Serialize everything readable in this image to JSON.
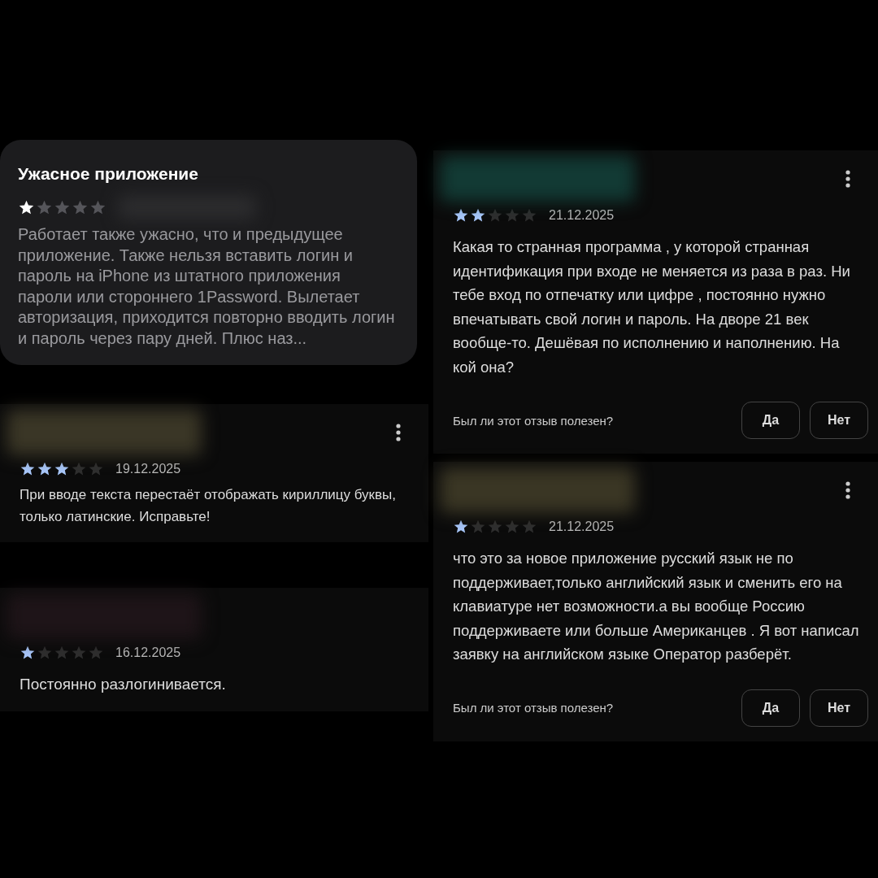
{
  "reviews": [
    {
      "kind": "ios",
      "title": "Ужасное приложение",
      "stars": 1,
      "body": "Работает также ужасно, что и предыдущее приложение. Также нельзя вставить логин и пароль на iPhone из штатного приложения пароли или стороннего 1Password. Вылетает авторизация, приходится повторно вводить логин и пароль через пару дней. Плюс наз..."
    },
    {
      "kind": "android",
      "menu": true,
      "stars": 3,
      "date": "19.12.2025",
      "body": "При вводе текста перестаёт отображать кириллицу буквы, только латинские. Исправьте!"
    },
    {
      "kind": "android",
      "menu": false,
      "stars": 1,
      "date": "16.12.2025",
      "body": "Постоянно разлогинивается."
    },
    {
      "kind": "android",
      "menu": true,
      "stars": 2,
      "date": "21.12.2025",
      "body": "Какая то странная программа , у которой странная идентификация при входе не меняется из раза в раз. Ни тебе вход по отпечатку или цифре , постоянно нужно впечатывать свой логин и пароль. На дворе 21 век вообще-то. Дешёвая по исполнению и наполнению. На кой она?",
      "helpful_prompt": "Был ли этот отзыв полезен?",
      "buttons": [
        "Да",
        "Нет"
      ]
    },
    {
      "kind": "android",
      "menu": true,
      "stars": 1,
      "date": "21.12.2025",
      "body": "что это за новое приложение русский язык не по поддерживает,только английский язык и сменить его на клавиатуре нет возможности.а вы вообще Россию поддерживаете или больше Американцев . Я вот написал заявку на английском языке Оператор разберёт.",
      "helpful_prompt": "Был ли этот отзыв полезен?",
      "buttons": [
        "Да",
        "Нет"
      ]
    }
  ]
}
